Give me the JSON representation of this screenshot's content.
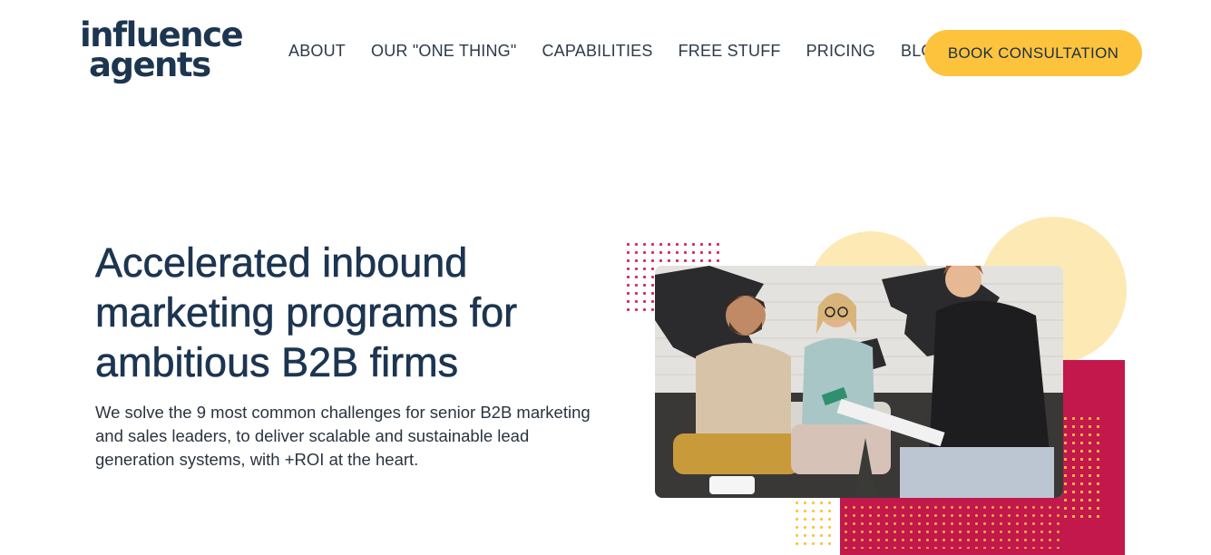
{
  "brand": {
    "logo_line1": "influence",
    "logo_line2": "agents"
  },
  "nav": {
    "items": [
      {
        "label": "ABOUT"
      },
      {
        "label": "OUR \"ONE THING\""
      },
      {
        "label": "CAPABILITIES"
      },
      {
        "label": "FREE STUFF"
      },
      {
        "label": "PRICING"
      },
      {
        "label": "BLOG"
      }
    ],
    "cta_label": "BOOK CONSULTATION"
  },
  "hero": {
    "title": "Accelerated inbound marketing programs for ambitious B2B firms",
    "subtitle": "We solve the 9 most common challenges for senior B2B marketing and sales leaders, to deliver scalable and sustainable lead generation systems, with +ROI at the heart."
  },
  "colors": {
    "primary_text": "#1c3550",
    "cta_yellow": "#fdc33d",
    "accent_crimson": "#c2184b",
    "soft_yellow": "#fde9b4"
  }
}
